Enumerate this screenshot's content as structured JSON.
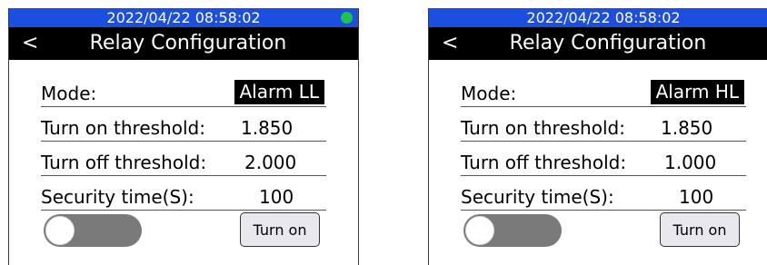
{
  "screens": [
    {
      "status": {
        "datetime": "2022/04/22  08:58:02"
      },
      "header": {
        "back": "<",
        "title": "Relay Configuration"
      },
      "mode": {
        "label": "Mode:",
        "value": "Alarm LL"
      },
      "turn_on": {
        "label": "Turn on threshold:",
        "value": "1.850"
      },
      "turn_off": {
        "label": "Turn off threshold:",
        "value": "2.000"
      },
      "security": {
        "label": "Security time(S):",
        "value": "100"
      },
      "toggle": {
        "state": "off"
      },
      "button": {
        "label": "Turn on"
      }
    },
    {
      "status": {
        "datetime": "2022/04/22  08:58:02"
      },
      "header": {
        "back": "<",
        "title": "Relay Configuration"
      },
      "mode": {
        "label": "Mode:",
        "value": "Alarm HL"
      },
      "turn_on": {
        "label": "Turn on threshold:",
        "value": "1.850"
      },
      "turn_off": {
        "label": "Turn off threshold:",
        "value": "1.000"
      },
      "security": {
        "label": "Security time(S):",
        "value": "100"
      },
      "toggle": {
        "state": "off"
      },
      "button": {
        "label": "Turn on"
      }
    }
  ],
  "colors": {
    "status_bar": "#1a4fe0",
    "status_dot": "#1fc24a",
    "title_bar": "#000000",
    "toggle_track": "#7a7a7a"
  }
}
